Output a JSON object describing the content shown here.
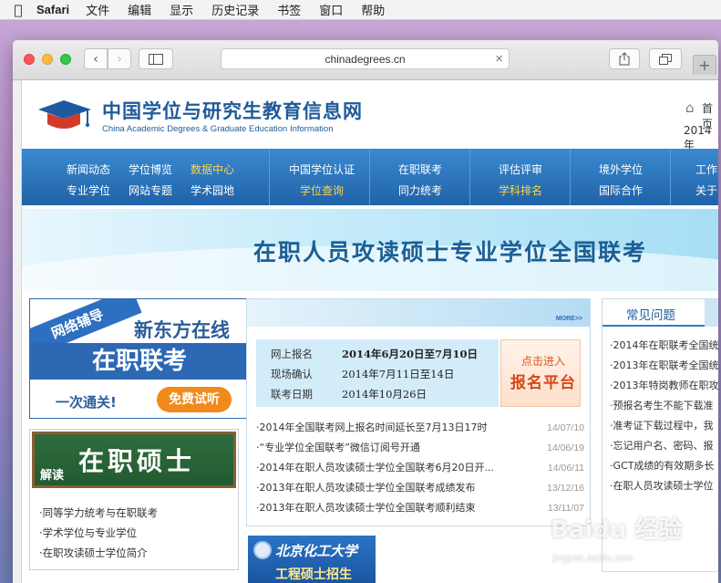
{
  "menubar": {
    "app": "Safari",
    "items": [
      "文件",
      "编辑",
      "显示",
      "历史记录",
      "书签",
      "窗口",
      "帮助"
    ]
  },
  "browser": {
    "url": "chinadegrees.cn"
  },
  "site": {
    "title": "中国学位与研究生教育信息网",
    "subtitle": "China Academic Degrees & Graduate Education Information",
    "home": "首页",
    "year": "2014年",
    "nav": [
      {
        "label": "新闻动态",
        "highlight": false
      },
      {
        "label": "学位博览",
        "highlight": false
      },
      {
        "label": "数据中心",
        "highlight": true
      },
      {
        "label": "专业学位",
        "highlight": false
      },
      {
        "label": "网站专题",
        "highlight": false
      },
      {
        "label": "学术园地",
        "highlight": false
      },
      {
        "label": "中国学位认证",
        "highlight": false
      },
      {
        "label": "学位查询",
        "highlight": true
      },
      {
        "label": "在职联考",
        "highlight": false
      },
      {
        "label": "同力统考",
        "highlight": false
      },
      {
        "label": "评估评审",
        "highlight": false
      },
      {
        "label": "学科排名",
        "highlight": true
      },
      {
        "label": "境外学位",
        "highlight": false
      },
      {
        "label": "国际合作",
        "highlight": false
      },
      {
        "label": "工作",
        "highlight": false
      },
      {
        "label": "关于",
        "highlight": false
      }
    ],
    "banner": "在职人员攻读硕士专业学位全国联考"
  },
  "ad_online": {
    "ribbon": "网络辅导",
    "brand": "新东方在线",
    "title": "在职联考",
    "slogan": "一次通关!",
    "trial": "免费试听"
  },
  "ad_master": {
    "tag": "解读",
    "title": "在职硕士",
    "links": [
      "·同等学力统考与在职联考",
      "·学术学位与专业学位",
      "·在职攻读硕士学位简介"
    ]
  },
  "registration": {
    "more": "MORE>>",
    "rows": [
      {
        "label": "网上报名",
        "value": "2014年6月20日至7月10日"
      },
      {
        "label": "现场确认",
        "value": "2014年7月11日至14日"
      },
      {
        "label": "联考日期",
        "value": "2014年10月26日"
      }
    ],
    "button_top": "点击进入",
    "button_main": "报名平台"
  },
  "news": [
    {
      "title": "·2014年全国联考网上报名时间延长至7月13日17时",
      "date": "14/07/10"
    },
    {
      "title": "·“专业学位全国联考”微信订阅号开通",
      "date": "14/06/19"
    },
    {
      "title": "·2014年在职人员攻读硕士学位全国联考6月20日开...",
      "date": "14/06/11"
    },
    {
      "title": "·2013年在职人员攻读硕士学位全国联考成绩发布",
      "date": "13/12/16"
    },
    {
      "title": "·2013年在职人员攻读硕士学位全国联考顺利结束",
      "date": "13/11/07"
    }
  ],
  "beijing_ad": {
    "school": "北京化工大学",
    "sub": "工程硕士招生"
  },
  "faq": {
    "tab": "常见问题",
    "items": [
      "·2014年在职联考全国统",
      "·2013年在职联考全国统",
      "·2013年特岗教师在职攻",
      "·预报名考生不能下载准",
      "·准考证下载过程中，我",
      "·忘记用户名、密码、报",
      "·GCT成绩的有效期多长",
      "·在职人员攻读硕士学位"
    ]
  },
  "watermark": {
    "text": "Baidu 经验",
    "url": "jingyan.baidu.com"
  }
}
